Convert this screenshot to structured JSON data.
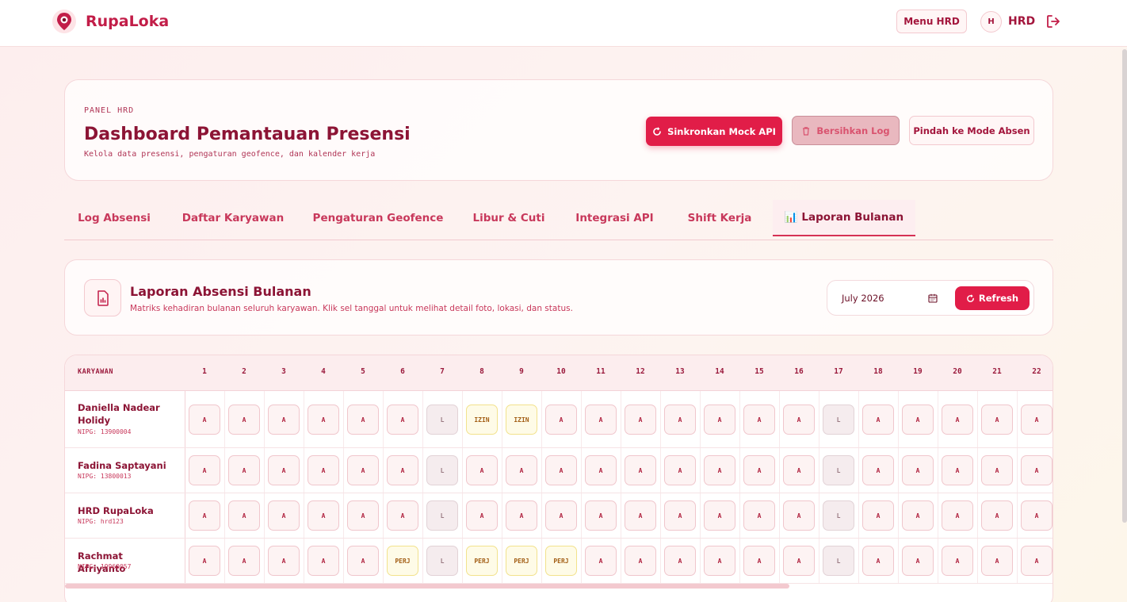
{
  "app": {
    "name": "RupaLoka"
  },
  "topbar": {
    "menu_label": "Menu HRD",
    "avatar_initial": "H",
    "user_name": "HRD"
  },
  "header": {
    "eyebrow": "PANEL HRD",
    "title": "Dashboard Pemantauan Presensi",
    "subtitle": "Kelola data presensi, pengaturan geofence, dan kalender kerja",
    "sync_label": "Sinkronkan Mock API",
    "clear_label": "Bersihkan Log",
    "mode_label": "Pindah ke Mode Absen"
  },
  "tabs": [
    {
      "label": "Log Absensi"
    },
    {
      "label": "Daftar Karyawan"
    },
    {
      "label": "Pengaturan Geofence"
    },
    {
      "label": "Libur & Cuti"
    },
    {
      "label": "Integrasi API"
    },
    {
      "label": "Shift Kerja"
    },
    {
      "label": "📊 Laporan Bulanan",
      "active": true
    }
  ],
  "report": {
    "title": "Laporan Absensi Bulanan",
    "description": "Matriks kehadiran bulanan seluruh karyawan. Klik sel tanggal untuk melihat detail foto, lokasi, dan status.",
    "month_value": "July 2026",
    "refresh_label": "Refresh"
  },
  "table": {
    "name_header": "KARYAWAN",
    "days": [
      "1",
      "2",
      "3",
      "4",
      "5",
      "6",
      "7",
      "8",
      "9",
      "10",
      "11",
      "12",
      "13",
      "14",
      "15",
      "16",
      "17",
      "18",
      "19",
      "20",
      "21",
      "22"
    ],
    "rows": [
      {
        "name": "Daniella Nadear Holidy",
        "nipg": "NIPG: 13900004",
        "cells": [
          "A",
          "A",
          "A",
          "A",
          "A",
          "A",
          "L",
          "IZIN",
          "IZIN",
          "A",
          "A",
          "A",
          "A",
          "A",
          "A",
          "A",
          "L",
          "A",
          "A",
          "A",
          "A",
          "A"
        ]
      },
      {
        "name": "Fadina Saptayani",
        "nipg": "NIPG: 13800013",
        "cells": [
          "A",
          "A",
          "A",
          "A",
          "A",
          "A",
          "L",
          "A",
          "A",
          "A",
          "A",
          "A",
          "A",
          "A",
          "A",
          "A",
          "L",
          "A",
          "A",
          "A",
          "A",
          "A"
        ]
      },
      {
        "name": "HRD RupaLoka",
        "nipg": "NIPG: hrd123",
        "cells": [
          "A",
          "A",
          "A",
          "A",
          "A",
          "A",
          "L",
          "A",
          "A",
          "A",
          "A",
          "A",
          "A",
          "A",
          "A",
          "A",
          "L",
          "A",
          "A",
          "A",
          "A",
          "A"
        ]
      },
      {
        "name": "Rachmat Afriyanto",
        "nipg": "NIPG: 19960057",
        "cells": [
          "A",
          "A",
          "A",
          "A",
          "A",
          "PERJ",
          "L",
          "PERJ",
          "PERJ",
          "PERJ",
          "A",
          "A",
          "A",
          "A",
          "A",
          "A",
          "L",
          "A",
          "A",
          "A",
          "A",
          "A"
        ]
      }
    ]
  },
  "colors": {
    "accent": "#e11d48",
    "text": "#8c1435",
    "present": "#fdf3f3",
    "leave": "#fefbe7",
    "holiday": "#f5ecee"
  }
}
